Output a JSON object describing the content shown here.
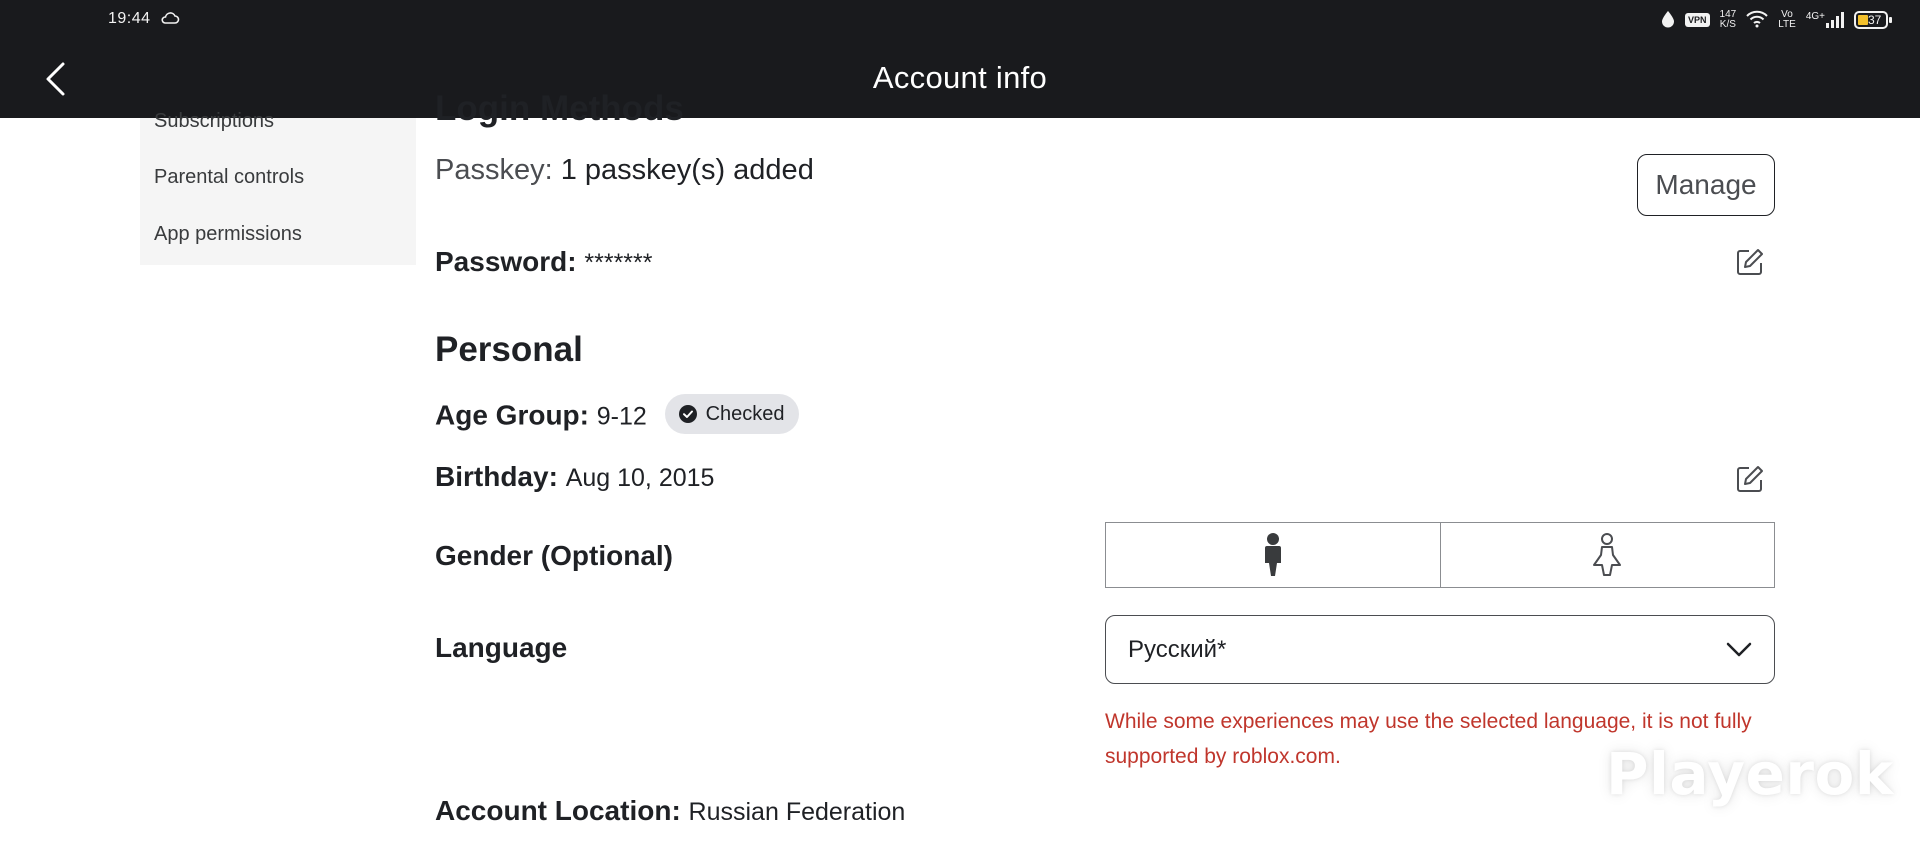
{
  "status_bar": {
    "time": "19:44",
    "vpn": "VPN",
    "net_speed_value": "147",
    "net_speed_unit": "K/S",
    "volte_top": "Vo",
    "volte_bottom": "LTE",
    "network": "4G+",
    "battery": "37",
    "battery_fill_percent": 37
  },
  "header": {
    "title": "Account info"
  },
  "sidebar": {
    "items": [
      {
        "label": "Subscriptions"
      },
      {
        "label": "Parental controls"
      },
      {
        "label": "App permissions"
      }
    ]
  },
  "login": {
    "heading_partial": "Login Methods",
    "passkey_label": "Passkey:",
    "passkey_value": "1 passkey(s) added",
    "manage_label": "Manage",
    "password_label": "Password:",
    "password_value": "*******"
  },
  "personal": {
    "heading": "Personal",
    "age_group_label": "Age Group:",
    "age_group_value": "9-12",
    "age_badge": "Checked",
    "birthday_label": "Birthday:",
    "birthday_value": "Aug 10, 2015",
    "gender_label": "Gender (Optional)",
    "gender_options": [
      "male",
      "female"
    ],
    "gender_selected": "male",
    "language_label": "Language",
    "language_value": "Русский*",
    "language_warning": "While some experiences may use the selected language, it is not fully supported by roblox.com.",
    "location_label": "Account Location:",
    "location_value": "Russian Federation"
  },
  "watermark": "Playerok",
  "colors": {
    "header_bg": "#191a1d",
    "warning": "#c0362c",
    "badge_bg": "#e3e4e8",
    "battery": "#f2c02c"
  }
}
